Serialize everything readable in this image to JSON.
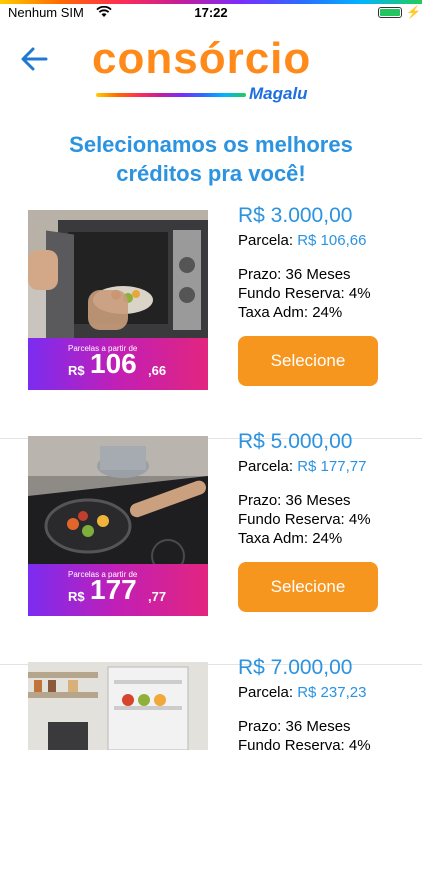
{
  "status_bar": {
    "carrier": "Nenhum SIM",
    "time": "17:22",
    "battery_level": 1.0
  },
  "header": {
    "logo_main": "consórcio",
    "logo_sub": "Magalu",
    "headline_line1": "Selecionamos os melhores",
    "headline_line2": "créditos pra você!"
  },
  "offers": [
    {
      "amount": "R$ 3.000,00",
      "parcela_label": "Parcela:",
      "parcela_value": "R$ 106,66",
      "prazo": "Prazo: 36 Meses",
      "fundo": "Fundo Reserva: 4%",
      "taxa": "Taxa Adm: 24%",
      "button": "Selecione",
      "promo_label": "Parcelas a partir de",
      "promo_currency": "R$",
      "promo_value": "106",
      "promo_cents": ",66",
      "image": "microwave-photo"
    },
    {
      "amount": "R$ 5.000,00",
      "parcela_label": "Parcela:",
      "parcela_value": "R$ 177,77",
      "prazo": "Prazo: 36 Meses",
      "fundo": "Fundo Reserva: 4%",
      "taxa": "Taxa Adm: 24%",
      "button": "Selecione",
      "promo_label": "Parcelas a partir de",
      "promo_currency": "R$",
      "promo_value": "177",
      "promo_cents": ",77",
      "image": "cooktop-photo"
    },
    {
      "amount": "R$ 7.000,00",
      "parcela_label": "Parcela:",
      "parcela_value": "R$ 237,23",
      "prazo": "Prazo: 36 Meses",
      "fundo": "Fundo Reserva: 4%",
      "image": "refrigerator-photo"
    }
  ],
  "colors": {
    "brand_orange": "#ff8a1a",
    "accent_blue": "#2b93e0",
    "button_orange": "#f7961e",
    "promo_purple": "#7b2cf0"
  }
}
